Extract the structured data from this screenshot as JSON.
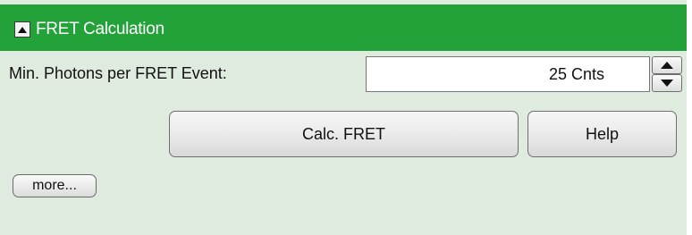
{
  "panel": {
    "title": "FRET Calculation",
    "collapse_icon": "triangle-up-icon",
    "header_color": "#22a238",
    "background_color": "#e0ebe0"
  },
  "min_photons": {
    "label": "Min. Photons per FRET Event:",
    "value": "25 Cnts",
    "increment_icon": "triangle-up-icon",
    "decrement_icon": "triangle-down-icon"
  },
  "buttons": {
    "calc_label": "Calc. FRET",
    "help_label": "Help",
    "more_label": "more..."
  }
}
